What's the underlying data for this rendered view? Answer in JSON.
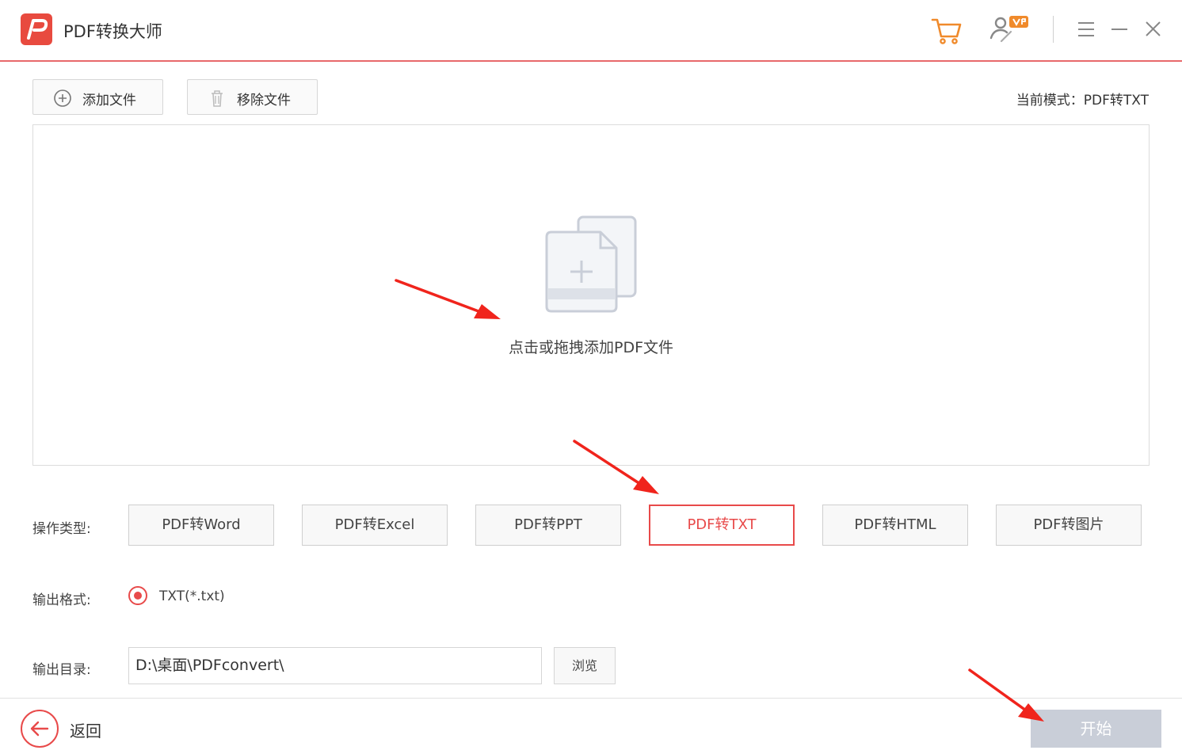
{
  "app": {
    "title": "PDF转换大师",
    "logo_icon": "pdf-logo-icon",
    "accent_color": "#e84a4a"
  },
  "titlebar": {
    "icons": [
      "cart-icon",
      "vip-user-icon",
      "menu-icon",
      "minimize-icon",
      "close-icon"
    ]
  },
  "toolbar": {
    "add_file_label": "添加文件",
    "remove_file_label": "移除文件",
    "mode_text": "当前模式：PDF转TXT"
  },
  "dropzone": {
    "hint": "点击或拖拽添加PDF文件",
    "icon": "add-file-icon"
  },
  "operation": {
    "label": "操作类型:",
    "options": [
      "PDF转Word",
      "PDF转Excel",
      "PDF转PPT",
      "PDF转TXT",
      "PDF转HTML",
      "PDF转图片"
    ],
    "selected": "PDF转TXT"
  },
  "output_format": {
    "label": "输出格式:",
    "option": "TXT(*.txt)"
  },
  "output_dir": {
    "label": "输出目录:",
    "value": "D:\\桌面\\PDFconvert\\",
    "browse_label": "浏览"
  },
  "footer": {
    "back_label": "返回",
    "start_label": "开始"
  }
}
